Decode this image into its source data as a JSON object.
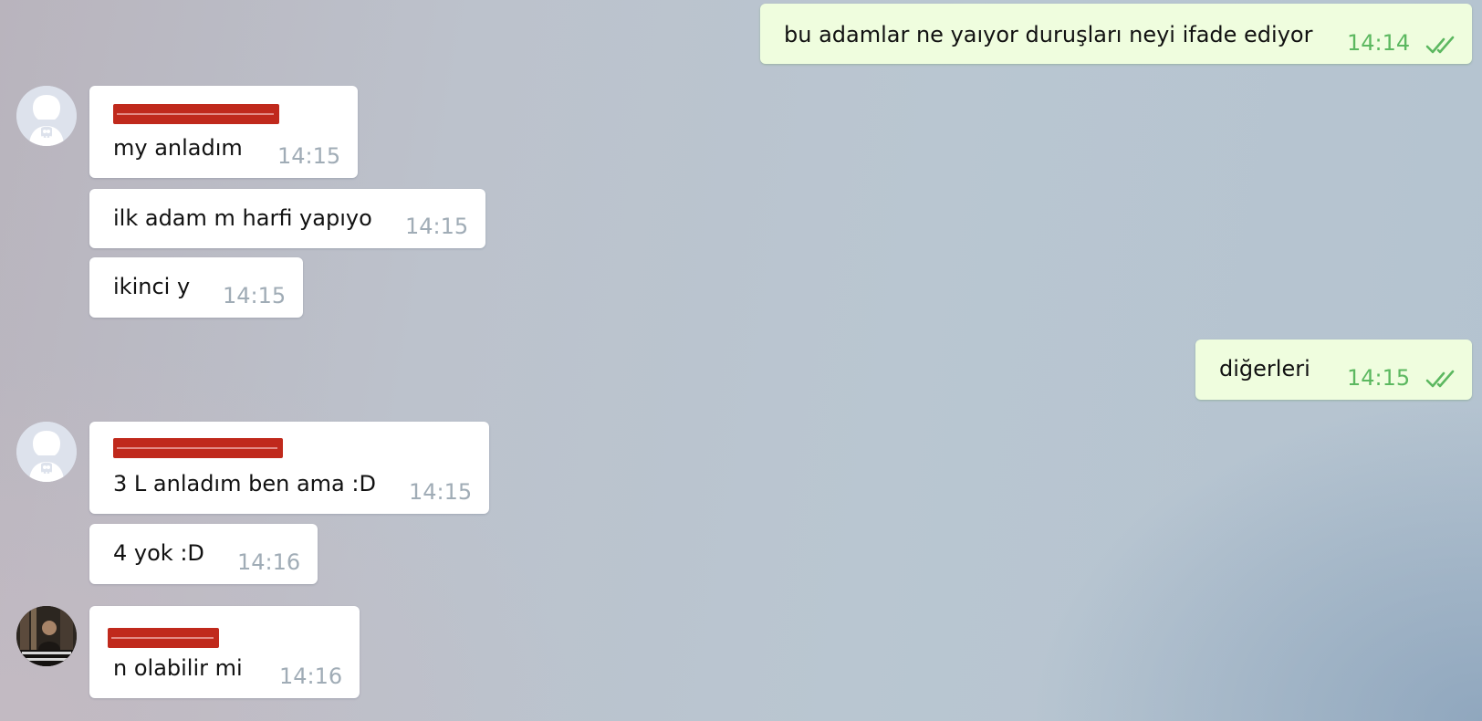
{
  "colors": {
    "incoming_bubble": "#ffffff",
    "outgoing_bubble": "#effdde",
    "time_incoming": "#a0acb6",
    "time_outgoing": "#5cb860",
    "redaction": "#c0291c"
  },
  "messages": [
    {
      "direction": "out",
      "text": "bu adamlar ne yaıyor duruşları neyi ifade ediyor",
      "time": "14:14",
      "status_icon": "double-check-icon"
    },
    {
      "direction": "in",
      "sender": "redacted",
      "avatar": "punisher-skull-avatar",
      "text": "my anladım",
      "time": "14:15"
    },
    {
      "direction": "in",
      "text": "ilk adam m harfi yapıyo",
      "time": "14:15"
    },
    {
      "direction": "in",
      "text": "ikinci y",
      "time": "14:15"
    },
    {
      "direction": "out",
      "text": "diğerleri",
      "time": "14:15",
      "status_icon": "double-check-icon"
    },
    {
      "direction": "in",
      "sender": "redacted",
      "avatar": "punisher-skull-avatar",
      "text": "3 L anladım ben ama :D",
      "time": "14:15"
    },
    {
      "direction": "in",
      "text": "4 yok :D",
      "time": "14:16"
    },
    {
      "direction": "in",
      "sender": "redacted",
      "avatar": "profile-photo-avatar",
      "text": "n olabilir mi",
      "time": "14:16"
    }
  ]
}
